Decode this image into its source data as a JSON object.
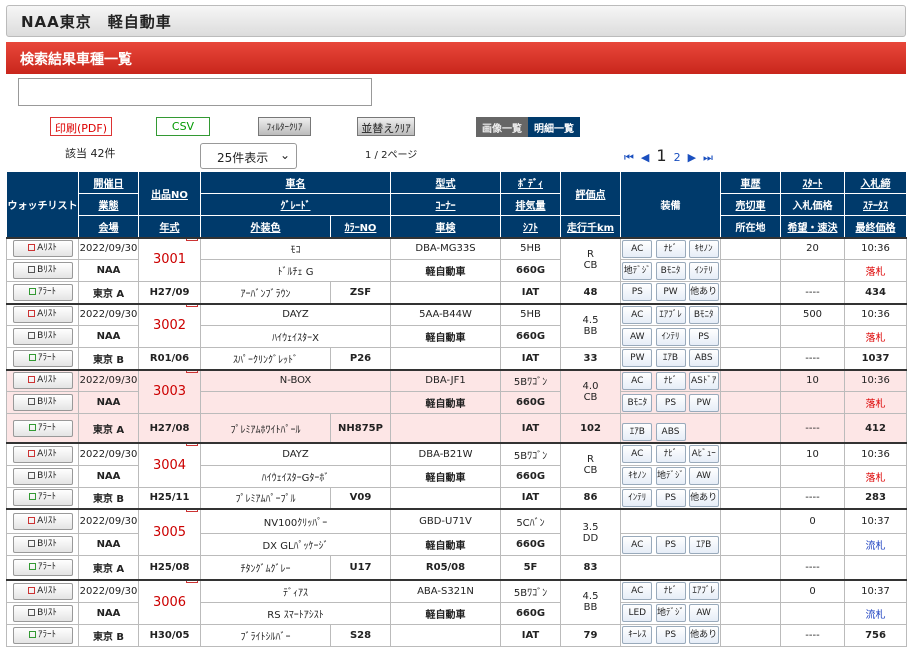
{
  "header": {
    "title": "NAA東京　軽自動車",
    "section": "検索結果車種一覧"
  },
  "toolbar": {
    "print_pdf": "印刷(PDF)",
    "csv": "CSV",
    "filter_clear": "ﾌｨﾙﾀｰｸﾘｱ",
    "sort_clear": "並替えｸﾘｱ",
    "image_list": "画像一覧",
    "detail_list": "明細一覧"
  },
  "summary": {
    "count": "該当 42件",
    "per_page": "25件表示",
    "page_info": "1 / 2ページ"
  },
  "pager": {
    "first": "⏮",
    "prev": "◀",
    "current": "1",
    "next_page": "2",
    "next": "▶",
    "last": "⏭"
  },
  "columns": {
    "watchlist": "ウォッチリスト",
    "date": "開催日",
    "org": "業態",
    "venue": "会場",
    "lot_no": "出品NO",
    "year": "年式",
    "car_name": "車名",
    "grade": "ｸﾞﾚｰﾄﾞ",
    "color": "外装色",
    "color_no": "ｶﾗｰNO",
    "model": "型式",
    "corner": "ｺｰﾅｰ",
    "inspection": "車検",
    "body": "ﾎﾞﾃﾞｨ",
    "displacement": "排気量",
    "shift": "ｼﾌﾄ",
    "score": "評価点",
    "mileage": "走行千km",
    "equipment": "装備",
    "history": "車歴",
    "sold": "売切車",
    "location": "所在地",
    "start": "ｽﾀｰﾄ",
    "bid_price": "入札価格",
    "wish": "希望・速決",
    "bid_end": "入札締",
    "status": "ｽﾃｰﾀｽ",
    "final": "最終価格"
  },
  "buttons": {
    "a_list": "Aﾘｽﾄ",
    "b_list": "Bﾘｽﾄ",
    "alert": "ｱﾗｰﾄ"
  },
  "rows": [
    {
      "date": "2022/09/30",
      "org": "NAA",
      "venue": "東京 A",
      "no": "3001",
      "year": "H27/09",
      "name": "ﾓｺ",
      "grade": "ﾄﾞﾙﾁｪ G",
      "color": "ｱｰﾊﾞﾝﾌﾞﾗｳﾝ",
      "color_no": "ZSF",
      "model": "DBA-MG33S",
      "corner": "軽自動車",
      "inspection": "",
      "body": "5HB",
      "disp": "660G",
      "shift": "IAT",
      "score1": "R",
      "score2": "CB",
      "km": "48",
      "eq": [
        "AC",
        "ﾅﾋﾞ",
        "ｷｾﾉﾝ",
        "地ﾃﾞｼﾞ",
        "Bﾓﾆﾀ",
        "ｲﾝﾃﾘ",
        "PS",
        "PW",
        "他あり"
      ],
      "start": "20",
      "wish": "----",
      "time": "10:36",
      "status": "落札",
      "final": "434",
      "pink": false
    },
    {
      "date": "2022/09/30",
      "org": "NAA",
      "venue": "東京 B",
      "no": "3002",
      "year": "R01/06",
      "name": "DAYZ",
      "grade": "ﾊｲｳｪｲｽﾀｰX",
      "color": "ｽﾊﾟｰｸﾘﾝｸﾞﾚｯﾄﾞ",
      "color_no": "P26",
      "model": "5AA-B44W",
      "corner": "軽自動車",
      "inspection": "",
      "body": "5HB",
      "disp": "660G",
      "shift": "IAT",
      "score1": "4.5",
      "score2": "BB",
      "km": "33",
      "eq": [
        "AC",
        "ｴｱﾌﾞﾚ",
        "Bﾓﾆﾀ",
        "AW",
        "ｲﾝﾃﾘ",
        "PS",
        "PW",
        "ｴｱB",
        "ABS"
      ],
      "start": "500",
      "wish": "----",
      "time": "10:36",
      "status": "落札",
      "final": "1037",
      "pink": false
    },
    {
      "date": "2022/09/30",
      "org": "NAA",
      "venue": "東京 A",
      "no": "3003",
      "year": "H27/08",
      "name": "N-BOX",
      "grade": "",
      "color": "ﾌﾟﾚﾐｱﾑﾎﾜｲﾄﾊﾟｰﾙ",
      "color_no": "NH875P",
      "model": "DBA-JF1",
      "corner": "軽自動車",
      "inspection": "",
      "body": "5Bﾜｺﾞﾝ",
      "disp": "660G",
      "shift": "IAT",
      "score1": "4.0",
      "score2": "CB",
      "km": "102",
      "eq": [
        "AC",
        "ﾅﾋﾞ",
        "ASﾄﾞｱ",
        "Bﾓﾆﾀ",
        "PS",
        "PW",
        "ｴｱB",
        "ABS"
      ],
      "start": "10",
      "wish": "----",
      "time": "10:36",
      "status": "落札",
      "final": "412",
      "pink": true
    },
    {
      "date": "2022/09/30",
      "org": "NAA",
      "venue": "東京 B",
      "no": "3004",
      "year": "H25/11",
      "name": "DAYZ",
      "grade": "ﾊｲｳｪｲｽﾀｰGﾀｰﾎﾞ",
      "color": "ﾌﾟﾚﾐｱﾑﾊﾟｰﾌﾟﾙ",
      "color_no": "V09",
      "model": "DBA-B21W",
      "corner": "軽自動車",
      "inspection": "",
      "body": "5Bﾜｺﾞﾝ",
      "disp": "660G",
      "shift": "IAT",
      "score1": "R",
      "score2": "CB",
      "km": "86",
      "eq": [
        "AC",
        "ﾅﾋﾞ",
        "Aﾋﾞｭｰ",
        "ｷｾﾉﾝ",
        "地ﾃﾞｼﾞ",
        "AW",
        "ｲﾝﾃﾘ",
        "PS",
        "他あり"
      ],
      "start": "10",
      "wish": "----",
      "time": "10:36",
      "status": "落札",
      "final": "283",
      "pink": false
    },
    {
      "date": "2022/09/30",
      "org": "NAA",
      "venue": "東京 A",
      "no": "3005",
      "year": "H25/08",
      "name": "NV100ｸﾘｯﾊﾟｰ",
      "grade": "DX GLﾊﾟｯｹｰｼﾞ",
      "color": "ﾁﾀﾝｸﾞﾑｸﾞﾚｰ",
      "color_no": "U17",
      "model": "GBD-U71V",
      "corner": "軽自動車",
      "inspection": "R05/08",
      "body": "5Cﾊﾞﾝ",
      "disp": "660G",
      "shift": "5F",
      "score1": "3.5",
      "score2": "DD",
      "km": "83",
      "eq": [
        "",
        "",
        "",
        "AC",
        "PS",
        "ｴｱB",
        "",
        "",
        ""
      ],
      "start": "0",
      "wish": "----",
      "time": "10:37",
      "status": "流札",
      "final": "",
      "pink": false
    },
    {
      "date": "2022/09/30",
      "org": "NAA",
      "venue": "東京 B",
      "no": "3006",
      "year": "H30/05",
      "name": "ﾃﾞｨｱｽ",
      "grade": "RS ｽﾏｰﾄｱｼｽﾄ",
      "color": "ﾌﾞﾗｲﾄｼﾙﾊﾞｰ",
      "color_no": "S28",
      "model": "ABA-S321N",
      "corner": "軽自動車",
      "inspection": "",
      "body": "5Bﾜｺﾞﾝ",
      "disp": "660G",
      "shift": "IAT",
      "score1": "4.5",
      "score2": "BB",
      "km": "79",
      "eq": [
        "AC",
        "ﾅﾋﾞ",
        "ｴｱﾌﾞﾚ",
        "LED",
        "地ﾃﾞｼﾞ",
        "AW",
        "ｷｰﾚｽ",
        "PS",
        "他あり"
      ],
      "start": "0",
      "wish": "----",
      "time": "10:37",
      "status": "流札",
      "final": "756",
      "pink": false
    }
  ],
  "colors": {
    "header_navy": "#003a6b",
    "red_bar": "#c9261c",
    "sold": "#d00",
    "unsold": "#1a3fc0",
    "row_pink": "#fde6e6"
  }
}
